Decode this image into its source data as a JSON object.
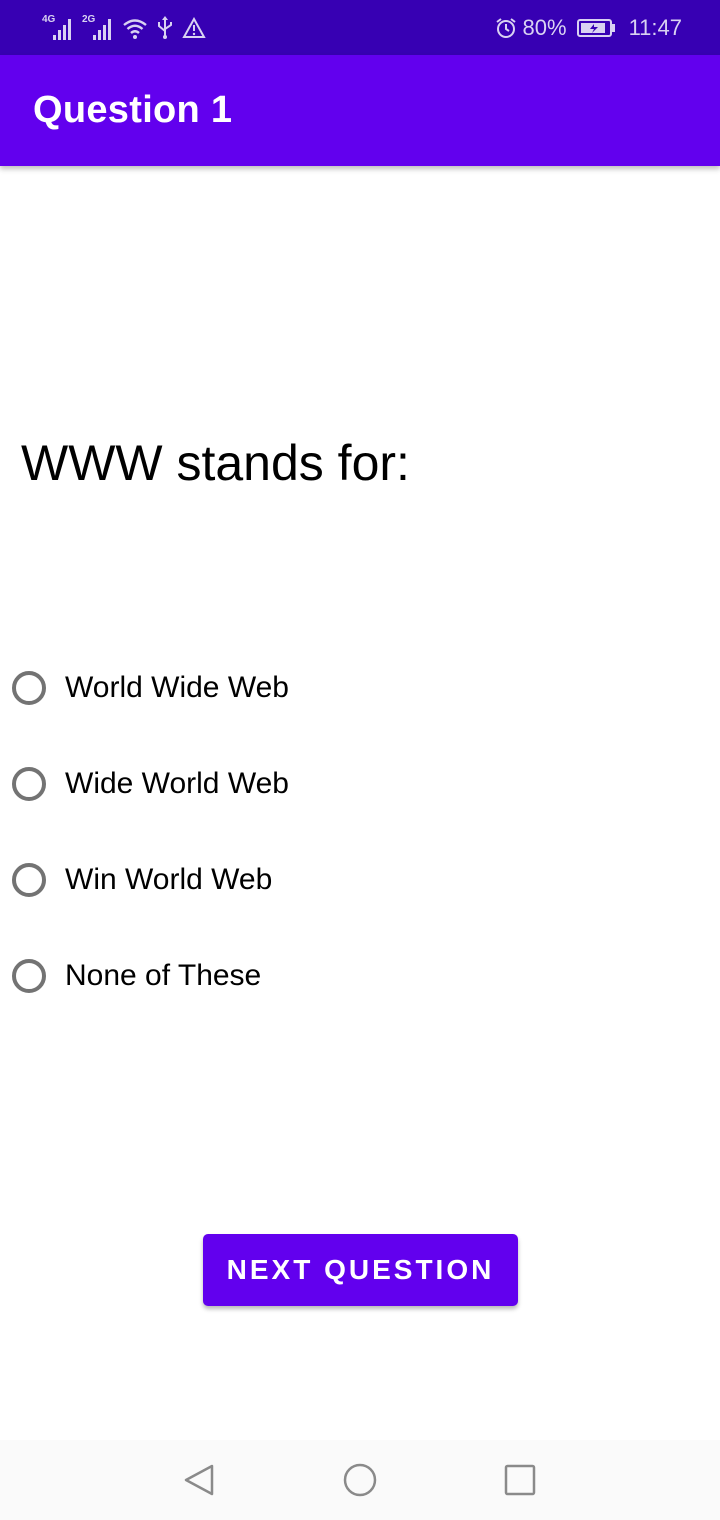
{
  "status_bar": {
    "network_1": "4G",
    "network_2": "2G",
    "battery_percent": "80%",
    "time": "11:47",
    "icons": [
      "signal-4g-icon",
      "signal-2g-icon",
      "wifi-icon",
      "usb-icon",
      "warning-icon",
      "alarm-icon",
      "battery-charging-icon"
    ]
  },
  "app_bar": {
    "title": "Question 1"
  },
  "question": {
    "text": "WWW stands for:"
  },
  "options": [
    {
      "label": "World Wide Web",
      "selected": false
    },
    {
      "label": "Wide World Web",
      "selected": false
    },
    {
      "label": "Win World Web",
      "selected": false
    },
    {
      "label": "None of These",
      "selected": false
    }
  ],
  "next_button": {
    "label": "NEXT QUESTION"
  },
  "nav_bar": {
    "icons": [
      "back-icon",
      "home-icon",
      "recents-icon"
    ]
  },
  "colors": {
    "status_bar": "#3700b3",
    "primary": "#6200ee",
    "radio_unchecked": "#737373"
  }
}
